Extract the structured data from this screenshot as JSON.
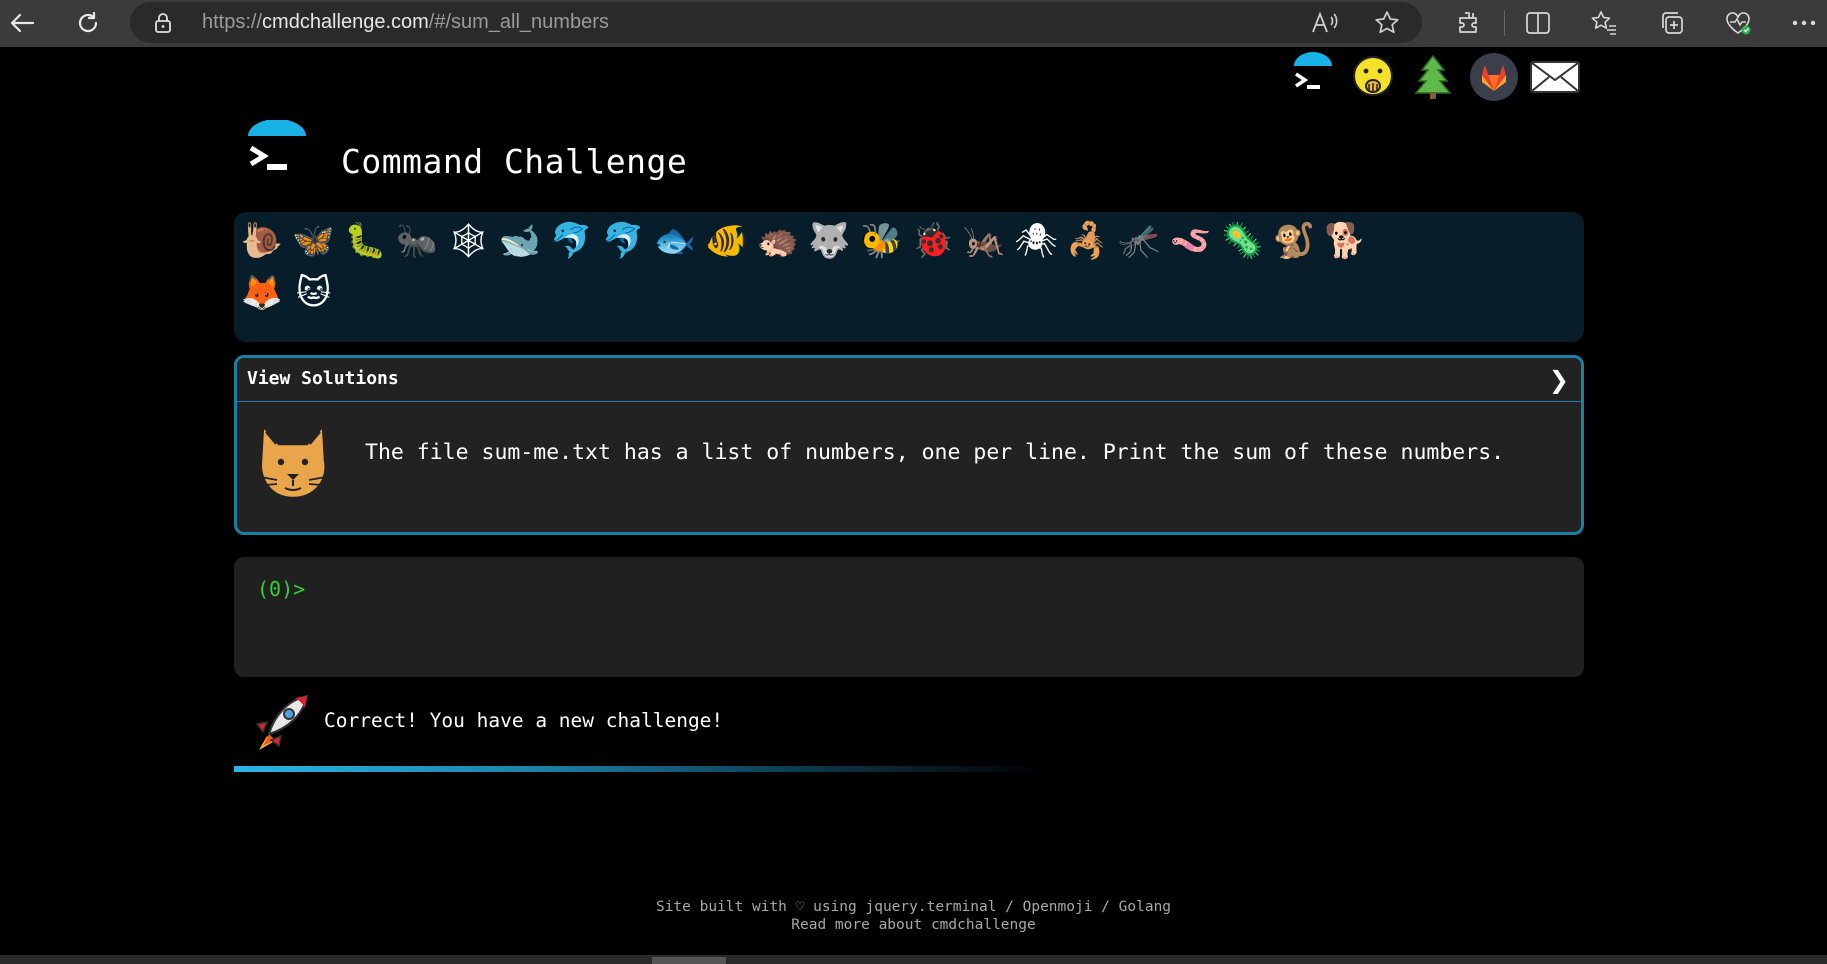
{
  "browser": {
    "url_prefix": "https://",
    "url_host": "cmdchallenge.com",
    "url_path": "/#/sum_all_numbers",
    "icons": [
      "back-arrow-icon",
      "refresh-icon",
      "lock-icon",
      "read-aloud-icon",
      "favorite-star-icon",
      "extensions-icon",
      "split-screen-icon",
      "favorites-icon",
      "collections-icon",
      "browser-essentials-icon",
      "more-icon"
    ]
  },
  "header": {
    "title": "Command Challenge",
    "social_icons": [
      "terminal-logo-icon",
      "shushing-face-icon",
      "tree-icon",
      "gitlab-icon",
      "mail-icon"
    ]
  },
  "animals": {
    "glyphs": [
      "🐌",
      "🦋",
      "🐛",
      "🐜",
      "🕸",
      "🐋",
      "🐬",
      "🐬",
      "🐟",
      "🐠",
      "🦔",
      "🐺",
      "🐝",
      "🐞",
      "🦗",
      "🕷",
      "🦂",
      "🦟",
      "🪱",
      "🦠",
      "🐒",
      "🐕",
      "🦊",
      "🐱"
    ],
    "names": [
      "snail",
      "butterfly",
      "caterpillar",
      "ant",
      "spider-web",
      "whale",
      "dolphin",
      "dolphin-grey",
      "fish",
      "tropical-fish",
      "hedgehog",
      "wolf",
      "bee",
      "ladybug",
      "cricket",
      "spider",
      "scorpion",
      "fly",
      "worm",
      "microbe",
      "monkey",
      "dog",
      "fox",
      "cat"
    ]
  },
  "challenge": {
    "header_label": "View Solutions",
    "text": "The file sum-me.txt has a list of numbers, one per line. Print the sum of these numbers."
  },
  "terminal": {
    "prompt": "(0)>"
  },
  "feedback": {
    "message": "Correct! You have a new challenge!",
    "progress_fraction": 0.6
  },
  "footer": {
    "line1": "Site built with ♡ using jquery.terminal / Openmoji / Golang",
    "line2": "Read more about cmdchallenge"
  },
  "colors": {
    "accent": "#1b7fa5",
    "prompt": "#2fd22f",
    "strip_bg": "#071d2a"
  }
}
